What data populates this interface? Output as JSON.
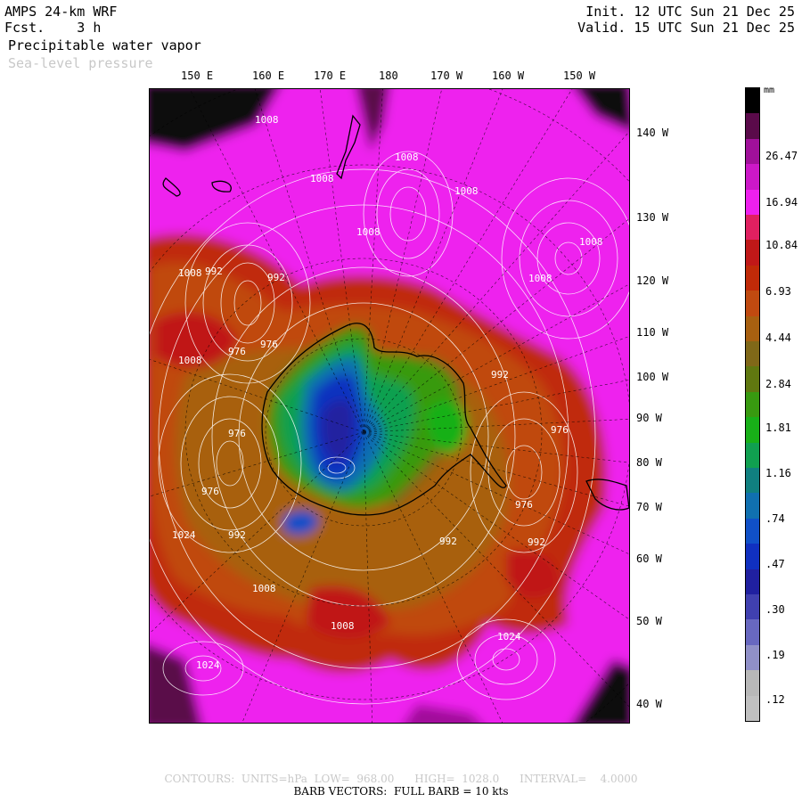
{
  "header": {
    "model": "AMPS 24-km WRF",
    "fcst_label": "Fcst.",
    "fcst_value": "3 h",
    "init": "Init. 12 UTC Sun 21 Dec 25",
    "valid": "Valid. 15 UTC Sun 21 Dec 25",
    "field1": "Precipitable water vapor",
    "field2": "Sea-level pressure"
  },
  "top_labels": [
    "150 E",
    "160 E",
    "170 E",
    "180",
    "170 W",
    "160 W",
    "150 W"
  ],
  "right_labels": [
    "140 W",
    "130 W",
    "120 W",
    "110 W",
    "100 W",
    "90 W",
    "80 W",
    "70 W",
    "60 W",
    "50 W",
    "40 W"
  ],
  "pressure_labels": [
    "1008",
    "1008",
    "1008",
    "1008",
    "1008",
    "1008",
    "1008",
    "992",
    "992",
    "992",
    "992",
    "992",
    "992",
    "976",
    "976",
    "976",
    "976",
    "976",
    "976",
    "1008",
    "1008",
    "1008",
    "1008",
    "1024",
    "1024",
    "1024"
  ],
  "colorbar": {
    "unit": "mm",
    "labels": [
      "26.47",
      "16.94",
      "10.84",
      "6.93",
      "4.44",
      "2.84",
      "1.81",
      "1.16",
      ".74",
      ".47",
      ".30",
      ".19",
      ".12"
    ],
    "colors": [
      "#000000",
      "#5a0a4a",
      "#a0109a",
      "#cc18c8",
      "#ee20ee",
      "#e02060",
      "#c01818",
      "#c02a08",
      "#c04a10",
      "#a86010",
      "#806818",
      "#607810",
      "#389a10",
      "#18b018",
      "#10a050",
      "#108080",
      "#1070b0",
      "#1050c8",
      "#1030c0",
      "#2020a0",
      "#4040b0",
      "#6868c0",
      "#9090c8",
      "#b8b8b8",
      "#c0c0c0"
    ]
  },
  "footer": {
    "contours": "CONTOURS:  UNITS=hPa  LOW=  968.00      HIGH=  1028.0      INTERVAL=    4.0000",
    "barbs": "BARB VECTORS:  FULL BARB = 10 kts"
  }
}
